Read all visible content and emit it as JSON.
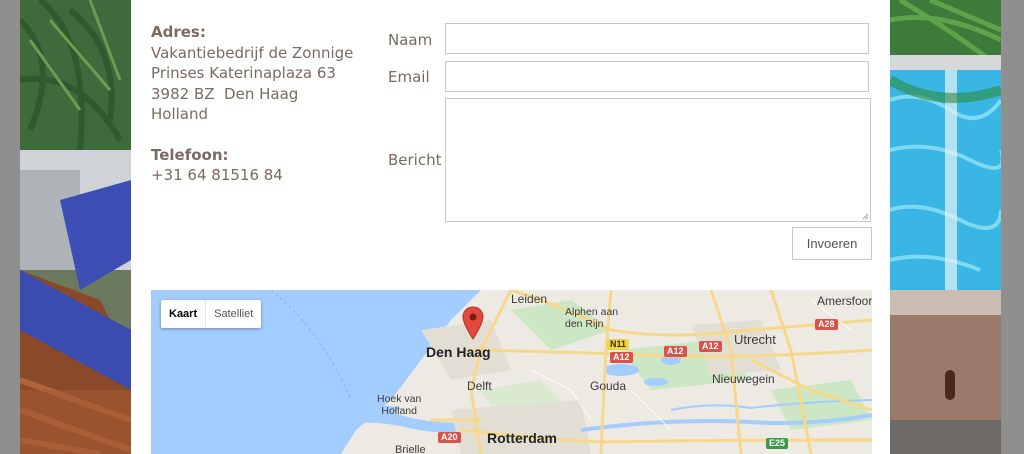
{
  "contact": {
    "address_label": "Adres:",
    "address_lines": [
      "Vakantiebedrijf de Zonnige",
      "Prinses Katerinaplaza 63",
      "3982 BZ  Den Haag",
      "Holland"
    ],
    "phone_label": "Telefoon:",
    "phone": "+31 64 81516 84"
  },
  "form": {
    "name_label": "Naam",
    "email_label": "Email",
    "message_label": "Bericht",
    "name_value": "",
    "email_value": "",
    "message_value": "",
    "submit_label": "Invoeren"
  },
  "map": {
    "type_buttons": [
      "Kaart",
      "Satelliet"
    ],
    "active_type": "Kaart",
    "places": {
      "den_haag": "Den Haag",
      "leiden": "Leiden",
      "alphen": "Alphen aan den Rijn",
      "amersfoort": "Amersfoor",
      "utrecht": "Utrecht",
      "delft": "Delft",
      "gouda": "Gouda",
      "nieuwegein": "Nieuwegein",
      "hoek_van_holland": "Hoek van Holland",
      "rotterdam": "Rotterdam",
      "brielle": "Brielle"
    },
    "roads": {
      "n11": "N11",
      "a12_1": "A12",
      "a12_2": "A12",
      "a12_3": "A12",
      "a28": "A28",
      "a20": "A20",
      "e25": "E25"
    },
    "colors": {
      "water": "#a3ccff",
      "land": "#eceae2",
      "road": "#f7d88a",
      "pin": "#e3483b"
    }
  }
}
